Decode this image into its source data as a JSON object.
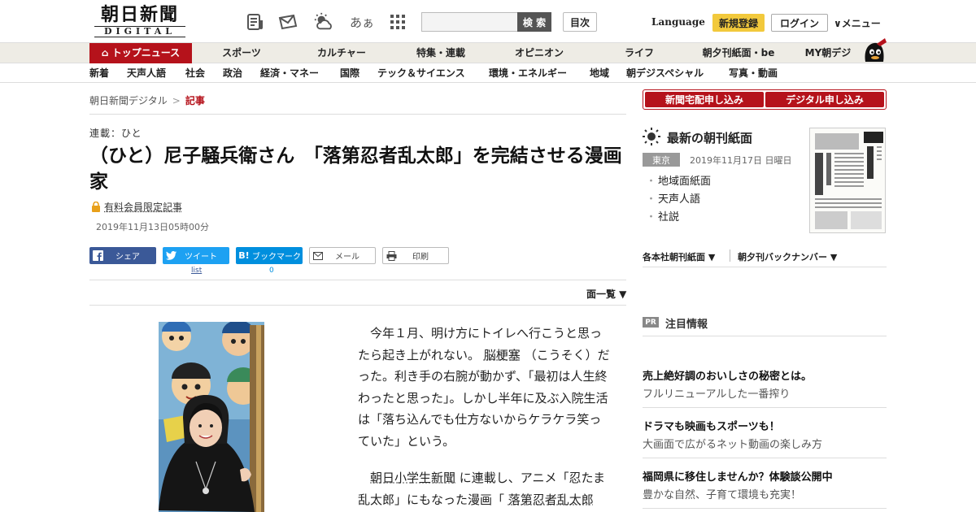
{
  "header": {
    "logo_main": "朝日新聞",
    "logo_sub": "DIGITAL",
    "icons": [
      "newspaper-icon",
      "mail-icon",
      "weather-icon",
      "font-size-icon",
      "apps-grid-icon"
    ],
    "font_size_label": "あぁ",
    "search_placeholder": "",
    "search_label": "検 索",
    "index_label": "目次",
    "language_label": "Language",
    "signup_label": "新規登録",
    "login_label": "ログイン",
    "menu_label": "∨メニュー"
  },
  "nav_primary": {
    "items": [
      "トップニュース",
      "スポーツ",
      "カルチャー",
      "特集・連載",
      "オピニオン",
      "ライフ",
      "朝夕刊紙面・be",
      "MY朝デジ"
    ],
    "active_index": 0
  },
  "nav_secondary": {
    "items": [
      "新着",
      "天声人語",
      "社会",
      "政治",
      "経済・マネー",
      "国際",
      "テック＆サイエンス",
      "環境・エネルギー",
      "地域",
      "朝デジスペシャル",
      "写真・動画"
    ]
  },
  "breadcrumb": {
    "home": "朝日新聞デジタル",
    "separator": ">",
    "current": "記事"
  },
  "article": {
    "series": "連載：ひと",
    "title": "（ひと）尼子騒兵衛さん　「落第忍者乱太郎」を完結させる漫画家",
    "paid_label": "有料会員限定記事",
    "date": "2019年11月13日05時00分",
    "share": {
      "facebook": "シェア",
      "twitter": "ツイート",
      "twitter_count": "list",
      "hatena": "ブックマーク",
      "hatena_icon": "B!",
      "hatena_count": "0",
      "mail": "メール",
      "print": "印刷"
    },
    "list_toggle": "面一覧 ▼",
    "p1_a": "今年１月、明け方にトイレへ行こうと思ったら起き上がれない。",
    "p1_link": "脳梗塞",
    "p1_b": "（こうそく）だった。利き手の右腕が動かず、「最初は人生終わったと思った」。しかし半年に及ぶ入院生活は「落ち込んでも仕方ないからケラケラ笑っていた」という。",
    "p2_link": "朝日小学生新聞",
    "p2_a": "に連載し、アニメ「忍たま乱太郎」にもなった漫画「",
    "p2_link2": "落第忍者乱太郎",
    "p2_b": ""
  },
  "sidebar": {
    "subscribe_paper": "新聞宅配申し込み",
    "subscribe_digital": "デジタル申し込み",
    "chokan_title": "最新の朝刊紙面",
    "region_badge": "東京",
    "chokan_date": "2019年11月17日 日曜日",
    "chokan_links": [
      "地域面紙面",
      "天声人語",
      "社説"
    ],
    "dropdown_1": "各本社朝刊紙面 ▼",
    "dropdown_2": "朝夕刊バックナンバー ▼",
    "pr_badge": "PR",
    "pr_title": "注目情報",
    "ads": [
      {
        "title": "売上絶好調のおいしさの秘密とは。",
        "sub": "フルリニューアルした一番搾り"
      },
      {
        "title": "ドラマも映画もスポーツも！",
        "sub": "大画面で広がるネット動画の楽しみ方"
      },
      {
        "title": "福岡県に移住しませんか？体験談公開中",
        "sub": "豊かな自然、子育て環境も充実！"
      }
    ]
  },
  "colors": {
    "brand_red": "#b5121b",
    "signup_yellow": "#f2c93c",
    "facebook": "#3b5998",
    "twitter": "#1da1f2",
    "hatena": "#008fde"
  }
}
